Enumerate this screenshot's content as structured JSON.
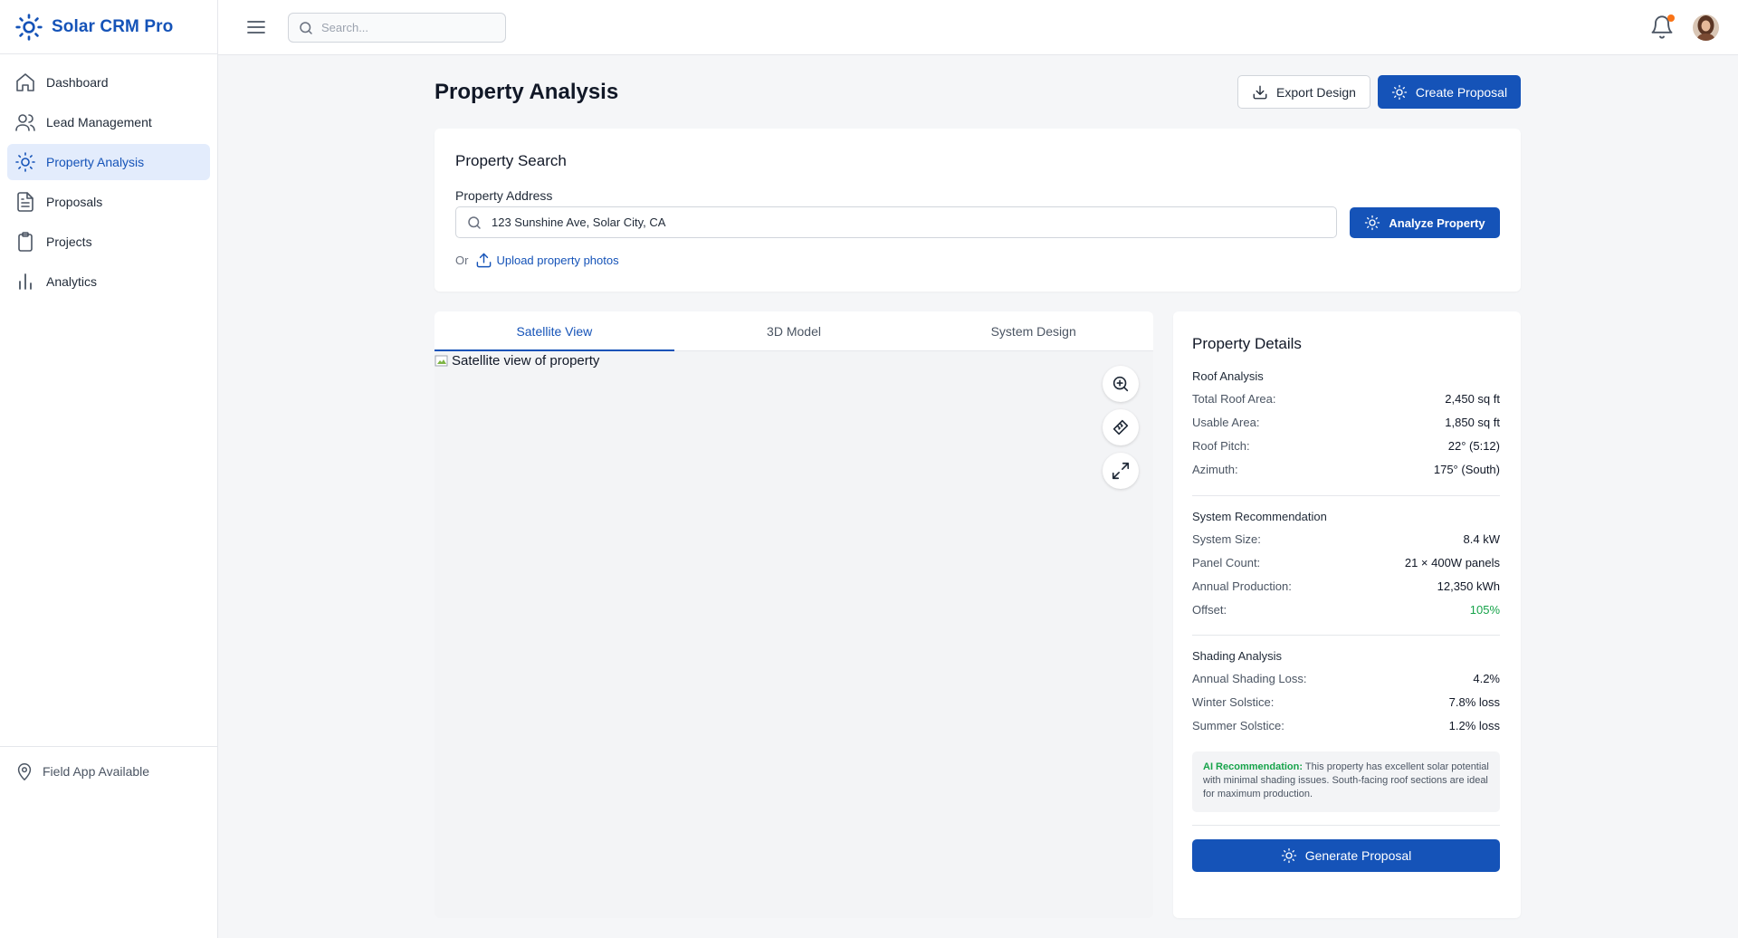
{
  "app": {
    "name": "Solar CRM Pro"
  },
  "sidebar": {
    "items": [
      {
        "label": "Dashboard",
        "icon": "home-icon"
      },
      {
        "label": "Lead Management",
        "icon": "users-icon"
      },
      {
        "label": "Property Analysis",
        "icon": "sun-icon",
        "active": true
      },
      {
        "label": "Proposals",
        "icon": "document-icon"
      },
      {
        "label": "Projects",
        "icon": "clipboard-icon"
      },
      {
        "label": "Analytics",
        "icon": "bar-chart-icon"
      }
    ],
    "footer_label": "Field App Available"
  },
  "topbar": {
    "search_placeholder": "Search...",
    "notifications_unread": true
  },
  "header": {
    "title": "Property Analysis",
    "export_label": "Export Design",
    "create_label": "Create Proposal"
  },
  "property_search": {
    "title": "Property Search",
    "address_label": "Property Address",
    "address_value": "123 Sunshine Ave, Solar City, CA",
    "analyze_label": "Analyze Property",
    "or_text": "Or",
    "upload_label": "Upload property photos"
  },
  "viewer": {
    "tabs": [
      {
        "label": "Satellite View",
        "active": true
      },
      {
        "label": "3D Model",
        "active": false
      },
      {
        "label": "System Design",
        "active": false
      }
    ],
    "image_alt": "Satellite view of property",
    "tools": [
      "zoom-in-icon",
      "ruler-icon",
      "expand-icon"
    ]
  },
  "details": {
    "title": "Property Details",
    "roof": {
      "title": "Roof Analysis",
      "rows": [
        {
          "k": "Total Roof Area:",
          "v": "2,450 sq ft"
        },
        {
          "k": "Usable Area:",
          "v": "1,850 sq ft"
        },
        {
          "k": "Roof Pitch:",
          "v": "22° (5:12)"
        },
        {
          "k": "Azimuth:",
          "v": "175° (South)"
        }
      ]
    },
    "system": {
      "title": "System Recommendation",
      "rows": [
        {
          "k": "System Size:",
          "v": "8.4 kW"
        },
        {
          "k": "Panel Count:",
          "v": "21 × 400W panels"
        },
        {
          "k": "Annual Production:",
          "v": "12,350 kWh"
        },
        {
          "k": "Offset:",
          "v": "105%"
        }
      ]
    },
    "shading": {
      "title": "Shading Analysis",
      "rows": [
        {
          "k": "Annual Shading Loss:",
          "v": "4.2%"
        },
        {
          "k": "Winter Solstice:",
          "v": "7.8% loss"
        },
        {
          "k": "Summer Solstice:",
          "v": "1.2% loss"
        }
      ]
    },
    "ai": {
      "label": "AI Recommendation:",
      "text": "This property has excellent solar potential with minimal shading issues. South-facing roof sections are ideal for maximum production."
    },
    "generate_label": "Generate Proposal"
  },
  "colors": {
    "brand": "#1553b8",
    "active_bg": "#e3ecfc",
    "positive": "#16a34a",
    "notification_dot": "#f97316"
  }
}
